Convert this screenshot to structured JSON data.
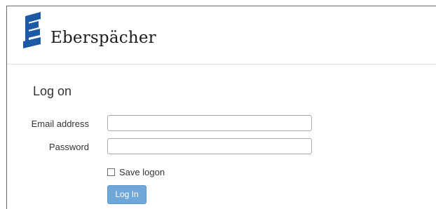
{
  "header": {
    "brand_name": "Eberspächer",
    "logo_icon": "eberspaecher-logo-icon",
    "brand_color": "#1d5aa6"
  },
  "main": {
    "title": "Log on",
    "email": {
      "label": "Email address",
      "value": "",
      "placeholder": ""
    },
    "password": {
      "label": "Password",
      "value": "",
      "placeholder": ""
    },
    "save_logon": {
      "label": "Save logon",
      "checked": false
    },
    "login_button": {
      "label": "Log In",
      "color": "#6fa7d8"
    }
  }
}
